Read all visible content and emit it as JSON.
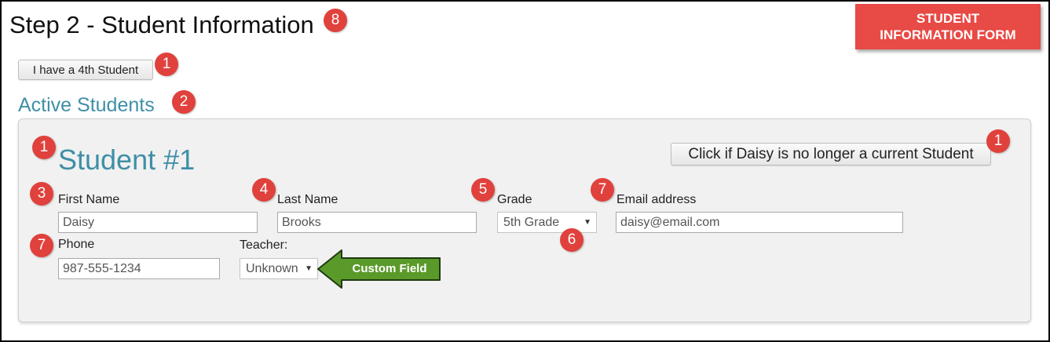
{
  "page": {
    "title": "Step 2 - Student Information",
    "banner_line1": "STUDENT",
    "banner_line2": "INFORMATION FORM"
  },
  "buttons": {
    "add_student": "I have a 4th Student",
    "remove_student": "Click if Daisy is no longer a current Student"
  },
  "section": {
    "title": "Active Students"
  },
  "student": {
    "heading": "Student #1",
    "first_name_label": "First Name",
    "first_name_value": "Daisy",
    "last_name_label": "Last Name",
    "last_name_value": "Brooks",
    "grade_label": "Grade",
    "grade_value": "5th Grade",
    "email_label": "Email address",
    "email_value": "daisy@email.com",
    "phone_label": "Phone",
    "phone_value": "987-555-1234",
    "teacher_label": "Teacher:",
    "teacher_value": "Unknown"
  },
  "callout": {
    "text": "Custom Field",
    "color": "#5a9a2a"
  },
  "badges": {
    "title": "8",
    "add_student": "1",
    "section": "2",
    "heading": "1",
    "remove": "1",
    "first_name": "3",
    "last_name": "4",
    "grade": "5",
    "grade_select": "6",
    "email": "7",
    "phone": "7"
  },
  "colors": {
    "badge": "#e0413c",
    "banner": "#e84a45",
    "heading": "#3f8fa6"
  },
  "icons": {
    "select_caret": "caret-down-icon"
  }
}
